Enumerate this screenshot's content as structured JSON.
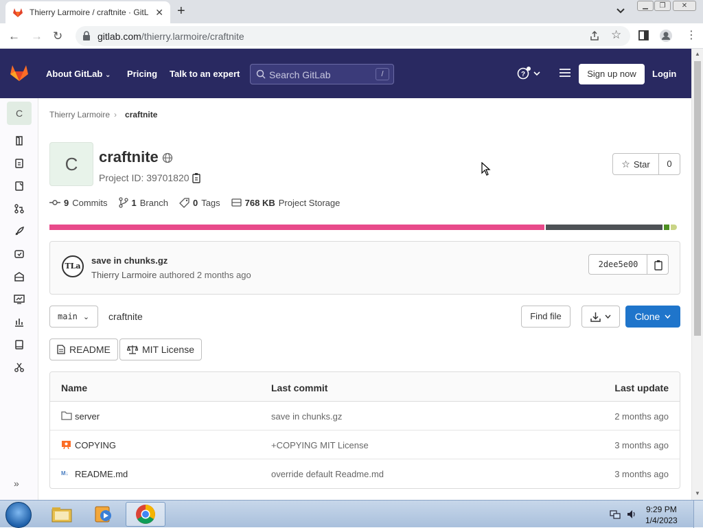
{
  "browser": {
    "tab_title": "Thierry Larmoire / craftnite · GitL",
    "url_domain": "gitlab.com",
    "url_path": "/thierry.larmoire/craftnite"
  },
  "gitlab_header": {
    "about": "About GitLab",
    "pricing": "Pricing",
    "talk": "Talk to an expert",
    "search_placeholder": "Search GitLab",
    "search_shortcut": "/",
    "signup": "Sign up now",
    "login": "Login"
  },
  "sidebar": {
    "project_letter": "C"
  },
  "breadcrumb": {
    "owner": "Thierry Larmoire",
    "project": "craftnite"
  },
  "project": {
    "avatar_letter": "C",
    "name": "craftnite",
    "id_text": "Project ID: 39701820",
    "star_label": "Star",
    "star_count": "0"
  },
  "stats": {
    "commits_count": "9",
    "commits_label": "Commits",
    "branch_count": "1",
    "branch_label": "Branch",
    "tags_count": "0",
    "tags_label": "Tags",
    "storage_size": "768 KB",
    "storage_label": "Project Storage"
  },
  "languages": [
    {
      "color": "#e84a8a",
      "fraction": 0.79
    },
    {
      "color": "#4e5256",
      "fraction": 0.186
    },
    {
      "color": "#4d8f21",
      "fraction": 0.009
    },
    {
      "color": "#c9d486",
      "fraction": 0.009
    }
  ],
  "commit": {
    "avatar_text": "TLa",
    "message": "save in chunks.gz",
    "author": "Thierry Larmoire",
    "when": "authored 2 months ago",
    "sha": "2dee5e00"
  },
  "controls": {
    "branch": "main",
    "path": "craftnite",
    "find_file": "Find file",
    "clone": "Clone"
  },
  "doc_buttons": {
    "readme": "README",
    "license": "MIT License"
  },
  "table": {
    "headers": {
      "name": "Name",
      "last_commit": "Last commit",
      "last_update": "Last update"
    },
    "rows": [
      {
        "name": "server",
        "commit": "save in chunks.gz",
        "updated": "2 months ago"
      },
      {
        "name": "COPYING",
        "commit": "+COPYING MIT License",
        "updated": "3 months ago"
      },
      {
        "name": "README.md",
        "commit": "override default Readme.md",
        "updated": "3 months ago"
      }
    ]
  },
  "taskbar": {
    "time": "9:29 PM",
    "date": "1/4/2023"
  },
  "colors": {
    "gitlab_nav": "#292961",
    "clone_blue": "#1f75cb"
  }
}
